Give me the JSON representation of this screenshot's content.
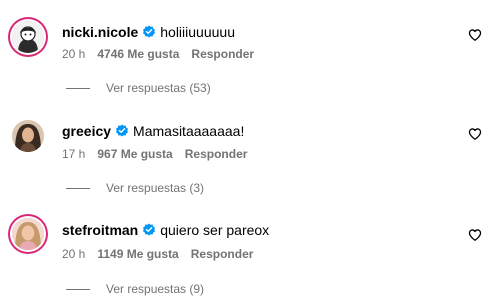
{
  "comments": [
    {
      "username": "nicki.nicole",
      "text": "holiiiuuuuuu",
      "time": "20 h",
      "likes": "4746 Me gusta",
      "reply_label": "Responder",
      "view_replies": "Ver respuestas (53)",
      "avatar_icon": "cartoon-portrait-avatar"
    },
    {
      "username": "greeicy",
      "text": "Mamasitaaaaaaa!",
      "time": "17 h",
      "likes": "967 Me gusta",
      "reply_label": "Responder",
      "view_replies": "Ver respuestas (3)",
      "avatar_icon": "photo-portrait-avatar"
    },
    {
      "username": "stefroitman",
      "text": "quiero ser pareox",
      "time": "20 h",
      "likes": "1149 Me gusta",
      "reply_label": "Responder",
      "view_replies": "Ver respuestas (9)",
      "avatar_icon": "photo-portrait-avatar"
    }
  ],
  "colors": {
    "verified": "#0095f6",
    "secondary_text": "#737373",
    "story_ring": "#d62976"
  }
}
